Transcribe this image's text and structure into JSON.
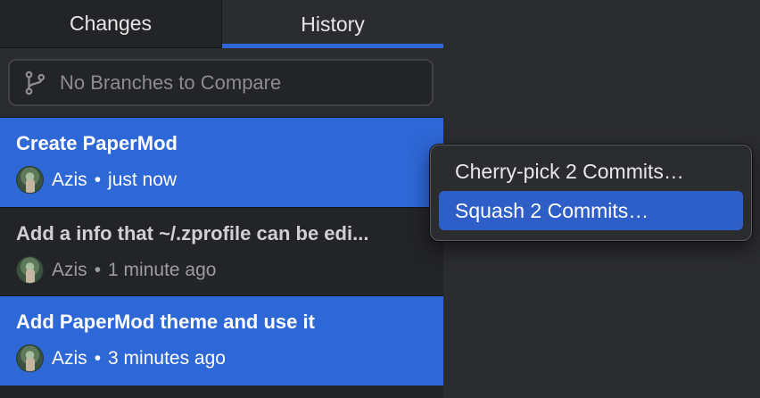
{
  "tabs": {
    "changes_label": "Changes",
    "history_label": "History",
    "active": "History"
  },
  "compare": {
    "icon": "branch-icon",
    "text": "No Branches to Compare"
  },
  "commits": [
    {
      "title": "Create PaperMod",
      "author": "Azis",
      "separator": "•",
      "time": "just now",
      "selected": true
    },
    {
      "title": "Add a info that ~/.zprofile can be edi...",
      "author": "Azis",
      "separator": "•",
      "time": "1 minute ago",
      "selected": false
    },
    {
      "title": "Add PaperMod theme and use it",
      "author": "Azis",
      "separator": "•",
      "time": "3 minutes ago",
      "selected": true
    }
  ],
  "context_menu": {
    "items": [
      {
        "label": "Cherry-pick 2 Commits…",
        "highlighted": false
      },
      {
        "label": "Squash 2 Commits…",
        "highlighted": true
      }
    ]
  },
  "colors": {
    "accent": "#2e67d6",
    "sidebar_bg": "#232427",
    "pane_bg": "#2b2c2f",
    "menu_highlight": "#2e5fc9"
  }
}
